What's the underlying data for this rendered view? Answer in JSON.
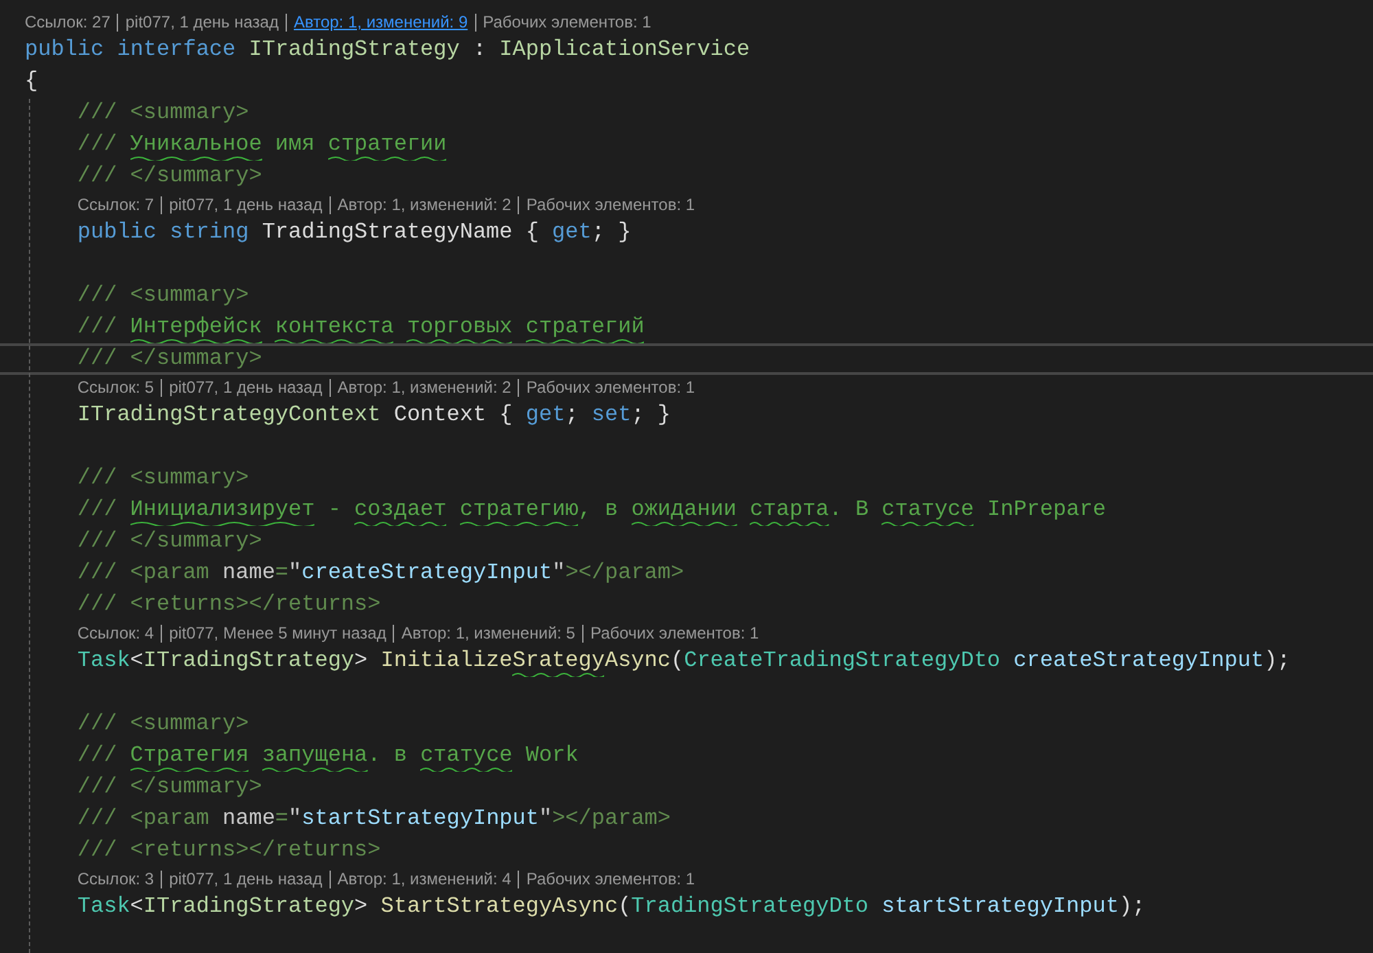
{
  "editor": {
    "lines": [
      {
        "kind": "lens",
        "parts": [
          {
            "text": "Ссылок: 27",
            "hovered": false
          },
          {
            "text": "pit077, 1 день назад",
            "hovered": false
          },
          {
            "text": "Автор: 1, изменений: 9",
            "hovered": true
          },
          {
            "text": "Рабочих элементов: 1",
            "hovered": false
          }
        ]
      },
      {
        "kind": "code",
        "current": false,
        "tokens": [
          {
            "t": "public interface ",
            "kind": "kw"
          },
          {
            "t": "ITradingStrategy",
            "kind": "iface"
          },
          {
            "t": " : ",
            "kind": "plain"
          },
          {
            "t": "IApplicationService",
            "kind": "iface"
          }
        ]
      },
      {
        "kind": "code",
        "current": false,
        "tokens": [
          {
            "t": "{",
            "kind": "plain"
          }
        ],
        "children": [
          {
            "kind": "code",
            "current": false,
            "tokens": [
              {
                "t": "/// <summary>",
                "kind": "doc"
              }
            ]
          },
          {
            "kind": "code",
            "current": false,
            "tokens": [
              {
                "t": "/// ",
                "kind": "doc"
              },
              {
                "t": "Уникальное",
                "kind": "cm",
                "squiggle": true
              },
              {
                "t": " имя",
                "kind": "cm"
              },
              {
                "t": " стратегии",
                "kind": "cm",
                "squiggle": true
              }
            ]
          },
          {
            "kind": "code",
            "current": false,
            "tokens": [
              {
                "t": "/// </summary>",
                "kind": "doc"
              }
            ]
          },
          {
            "kind": "lens",
            "parts": [
              {
                "text": "Ссылок: 7",
                "hovered": false
              },
              {
                "text": "pit077, 1 день назад",
                "hovered": false
              },
              {
                "text": "Автор: 1, изменений: 2",
                "hovered": false
              },
              {
                "text": "Рабочих элементов: 1",
                "hovered": false
              }
            ]
          },
          {
            "kind": "code",
            "current": false,
            "tokens": [
              {
                "t": "public string ",
                "kind": "kw"
              },
              {
                "t": "TradingStrategyName { ",
                "kind": "plain"
              },
              {
                "t": "get",
                "kind": "kw"
              },
              {
                "t": "; }",
                "kind": "plain"
              }
            ]
          },
          {
            "kind": "blank"
          },
          {
            "kind": "code",
            "current": false,
            "tokens": [
              {
                "t": "/// <summary>",
                "kind": "doc"
              }
            ]
          },
          {
            "kind": "code",
            "current": false,
            "tokens": [
              {
                "t": "/// ",
                "kind": "doc"
              },
              {
                "t": "Интерфейск",
                "kind": "cm",
                "squiggle": true
              },
              {
                "t": " контекста",
                "kind": "cm",
                "squiggle": true
              },
              {
                "t": " торговых",
                "kind": "cm",
                "squiggle": true
              },
              {
                "t": " стратегий",
                "kind": "cm",
                "squiggle": true
              }
            ]
          },
          {
            "kind": "code",
            "current": true,
            "tokens": [
              {
                "t": "/// </summary>",
                "kind": "doc"
              }
            ]
          },
          {
            "kind": "lens",
            "parts": [
              {
                "text": "Ссылок: 5",
                "hovered": false
              },
              {
                "text": "pit077, 1 день назад",
                "hovered": false
              },
              {
                "text": "Автор: 1, изменений: 2",
                "hovered": false
              },
              {
                "text": "Рабочих элементов: 1",
                "hovered": false
              }
            ]
          },
          {
            "kind": "code",
            "current": false,
            "tokens": [
              {
                "t": "ITradingStrategyContext",
                "kind": "iface"
              },
              {
                "t": " Context { ",
                "kind": "plain"
              },
              {
                "t": "get",
                "kind": "kw"
              },
              {
                "t": "; ",
                "kind": "plain"
              },
              {
                "t": "set",
                "kind": "kw"
              },
              {
                "t": "; }",
                "kind": "plain"
              }
            ]
          },
          {
            "kind": "blank"
          },
          {
            "kind": "code",
            "current": false,
            "tokens": [
              {
                "t": "/// <summary>",
                "kind": "doc"
              }
            ]
          },
          {
            "kind": "code",
            "current": false,
            "tokens": [
              {
                "t": "/// ",
                "kind": "doc"
              },
              {
                "t": "Инициализирует",
                "kind": "cm",
                "squiggle": true
              },
              {
                "t": " -",
                "kind": "cm"
              },
              {
                "t": " создает",
                "kind": "cm",
                "squiggle": true
              },
              {
                "t": " стратегию",
                "kind": "cm",
                "squiggle": true
              },
              {
                "t": ", в",
                "kind": "cm"
              },
              {
                "t": " ожидании",
                "kind": "cm",
                "squiggle": true
              },
              {
                "t": " старта",
                "kind": "cm",
                "squiggle": true
              },
              {
                "t": ". В",
                "kind": "cm"
              },
              {
                "t": " статусе",
                "kind": "cm",
                "squiggle": true
              },
              {
                "t": " InPrepare",
                "kind": "cm"
              }
            ]
          },
          {
            "kind": "code",
            "current": false,
            "tokens": [
              {
                "t": "/// </summary>",
                "kind": "doc"
              }
            ]
          },
          {
            "kind": "code",
            "current": false,
            "tokens": [
              {
                "t": "/// <param ",
                "kind": "doc"
              },
              {
                "t": "name",
                "kind": "attr"
              },
              {
                "t": "=",
                "kind": "doc"
              },
              {
                "t": "\"",
                "kind": "str"
              },
              {
                "t": "createStrategyInput",
                "kind": "param"
              },
              {
                "t": "\"",
                "kind": "str"
              },
              {
                "t": "></param>",
                "kind": "doc"
              }
            ]
          },
          {
            "kind": "code",
            "current": false,
            "tokens": [
              {
                "t": "/// <returns></returns>",
                "kind": "doc"
              }
            ]
          },
          {
            "kind": "lens",
            "parts": [
              {
                "text": "Ссылок: 4",
                "hovered": false
              },
              {
                "text": "pit077, Менее 5 минут назад",
                "hovered": false
              },
              {
                "text": "Автор: 1, изменений: 5",
                "hovered": false
              },
              {
                "text": "Рабочих элементов: 1",
                "hovered": false
              }
            ]
          },
          {
            "kind": "code",
            "current": false,
            "tokens": [
              {
                "t": "Task",
                "kind": "cls"
              },
              {
                "t": "<",
                "kind": "plain"
              },
              {
                "t": "ITradingStrategy",
                "kind": "iface"
              },
              {
                "t": "> ",
                "kind": "plain"
              },
              {
                "t": "Initialize",
                "kind": "method"
              },
              {
                "t": "Srategy",
                "kind": "method",
                "squiggle": true
              },
              {
                "t": "Async",
                "kind": "method"
              },
              {
                "t": "(",
                "kind": "plain"
              },
              {
                "t": "CreateTradingStrategyDto",
                "kind": "cls"
              },
              {
                "t": " createStrategyInput",
                "kind": "param"
              },
              {
                "t": ");",
                "kind": "plain"
              }
            ]
          },
          {
            "kind": "blank"
          },
          {
            "kind": "code",
            "current": false,
            "tokens": [
              {
                "t": "/// <summary>",
                "kind": "doc"
              }
            ]
          },
          {
            "kind": "code",
            "current": false,
            "tokens": [
              {
                "t": "/// ",
                "kind": "doc"
              },
              {
                "t": "Стратегия",
                "kind": "cm",
                "squiggle": true
              },
              {
                "t": " запущена",
                "kind": "cm",
                "squiggle": true
              },
              {
                "t": ". в",
                "kind": "cm"
              },
              {
                "t": " статусе",
                "kind": "cm",
                "squiggle": true
              },
              {
                "t": " Work",
                "kind": "cm"
              }
            ]
          },
          {
            "kind": "code",
            "current": false,
            "tokens": [
              {
                "t": "/// </summary>",
                "kind": "doc"
              }
            ]
          },
          {
            "kind": "code",
            "current": false,
            "tokens": [
              {
                "t": "/// <param ",
                "kind": "doc"
              },
              {
                "t": "name",
                "kind": "attr"
              },
              {
                "t": "=",
                "kind": "doc"
              },
              {
                "t": "\"",
                "kind": "str"
              },
              {
                "t": "startStrategyInput",
                "kind": "param"
              },
              {
                "t": "\"",
                "kind": "str"
              },
              {
                "t": "></param>",
                "kind": "doc"
              }
            ]
          },
          {
            "kind": "code",
            "current": false,
            "tokens": [
              {
                "t": "/// <returns></returns>",
                "kind": "doc"
              }
            ]
          },
          {
            "kind": "lens",
            "parts": [
              {
                "text": "Ссылок: 3",
                "hovered": false
              },
              {
                "text": "pit077, 1 день назад",
                "hovered": false
              },
              {
                "text": "Автор: 1, изменений: 4",
                "hovered": false
              },
              {
                "text": "Рабочих элементов: 1",
                "hovered": false
              }
            ]
          },
          {
            "kind": "code",
            "current": false,
            "tokens": [
              {
                "t": "Task",
                "kind": "cls"
              },
              {
                "t": "<",
                "kind": "plain"
              },
              {
                "t": "ITradingStrategy",
                "kind": "iface"
              },
              {
                "t": "> ",
                "kind": "plain"
              },
              {
                "t": "StartStrategyAsync",
                "kind": "method"
              },
              {
                "t": "(",
                "kind": "plain"
              },
              {
                "t": "TradingStrategyDto",
                "kind": "cls"
              },
              {
                "t": " startStrategyInput",
                "kind": "param"
              },
              {
                "t": ");",
                "kind": "plain"
              }
            ]
          },
          {
            "kind": "blank"
          }
        ]
      }
    ]
  }
}
